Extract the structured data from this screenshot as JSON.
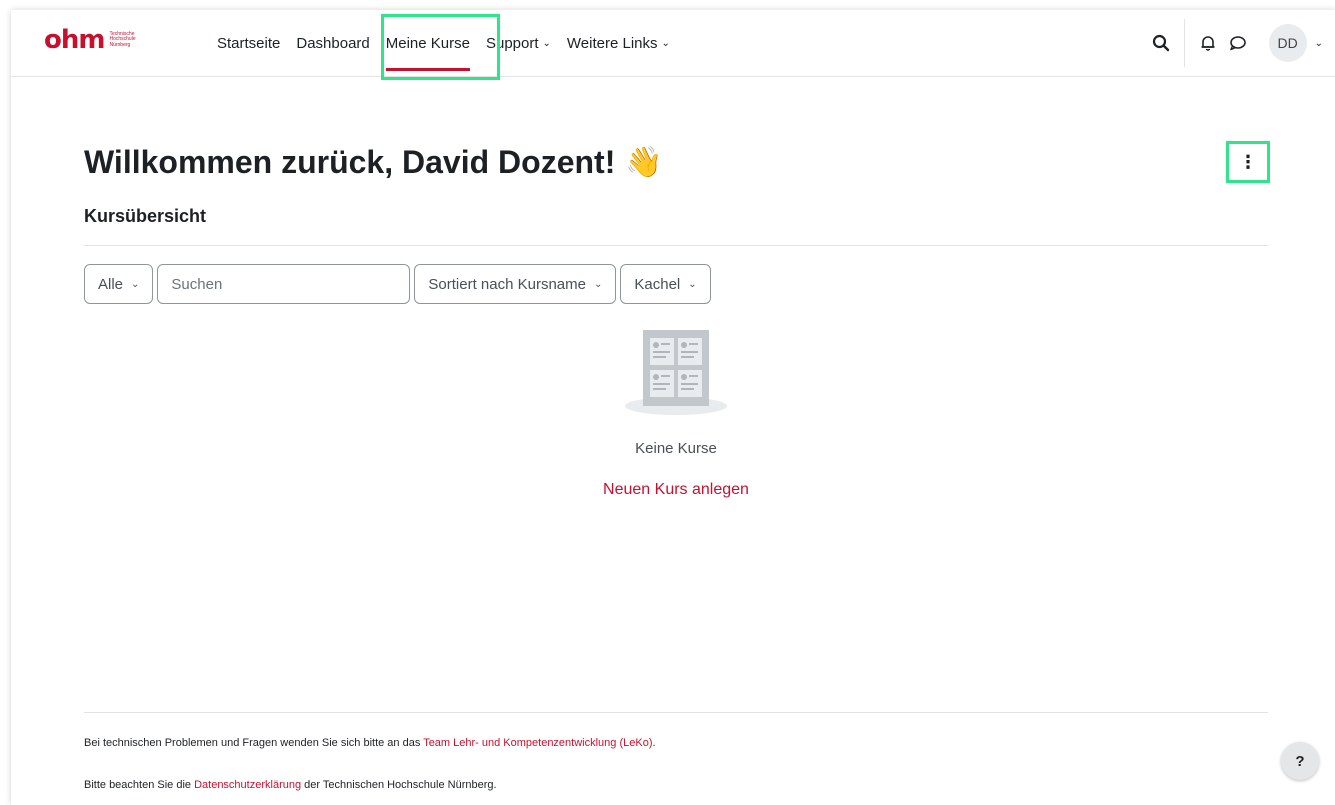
{
  "brand": {
    "logo_text": "ohm",
    "logo_sub": [
      "Technische",
      "Hochschule",
      "Nürnberg"
    ],
    "accent_color": "#c8102e",
    "highlight_color": "#2ee58c"
  },
  "nav": {
    "items": [
      {
        "label": "Startseite",
        "dropdown": false,
        "active": false
      },
      {
        "label": "Dashboard",
        "dropdown": false,
        "active": false
      },
      {
        "label": "Meine Kurse",
        "dropdown": false,
        "active": true
      },
      {
        "label": "Support",
        "dropdown": true,
        "active": false
      },
      {
        "label": "Weitere Links",
        "dropdown": true,
        "active": false
      }
    ],
    "chevron": "⌄",
    "icons": [
      "search-icon",
      "bell-icon",
      "message-icon"
    ],
    "avatar_initials": "DD"
  },
  "main": {
    "welcome_title": "Willkommen zurück, David Dozent!",
    "wave_emoji": "👋",
    "menu_glyph": "⋮",
    "section_title": "Kursübersicht",
    "filter_label": "Alle",
    "search_placeholder": "Suchen",
    "sort_label": "Sortiert nach Kursname",
    "view_label": "Kachel",
    "empty_text": "Keine Kurse",
    "new_course_link": "Neuen Kurs anlegen"
  },
  "footer": {
    "line1_prefix": "Bei technischen Problemen und Fragen wenden Sie sich bitte an das ",
    "line1_link": "Team Lehr- und Kompetenzentwicklung (LeKo)",
    "line1_suffix": ".",
    "line2_prefix": "Bitte beachten Sie die ",
    "line2_link": "Datenschutzerklärung",
    "line2_suffix": " der Technischen Hochschule Nürnberg."
  },
  "help": {
    "label": "?"
  }
}
